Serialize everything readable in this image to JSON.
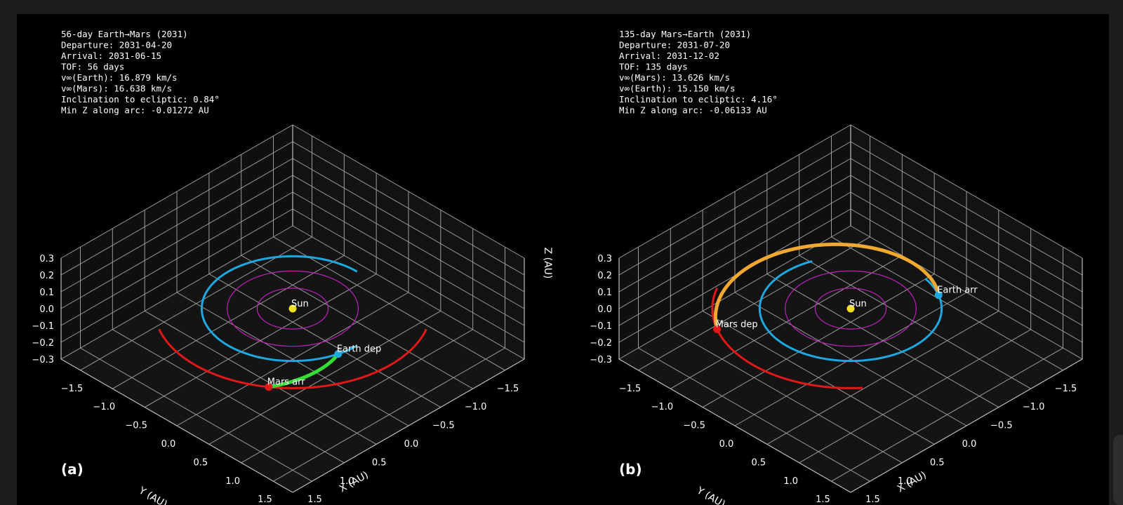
{
  "chart_data": [
    {
      "type": "line3d",
      "panel_label": "(a)",
      "info_lines": [
        "56-day Earth→Mars (2031)",
        "Departure: 2031-04-20",
        "Arrival:   2031-06-15",
        "TOF: 56 days",
        "v∞(Earth):  16.879 km/s",
        "v∞(Mars):  16.638 km/s",
        "Inclination to ecliptic:  0.84°",
        "Min Z along arc: -0.01272 AU"
      ],
      "xlabel": "X (AU)",
      "ylabel": "Y (AU)",
      "zlabel": "Z (AU)",
      "xlim": [
        -1.8,
        1.8
      ],
      "ylim": [
        -1.8,
        1.8
      ],
      "zlim": [
        -0.3,
        0.3
      ],
      "xticks": [
        -1.5,
        -1.0,
        -0.5,
        0.0,
        0.5,
        1.0,
        1.5
      ],
      "yticks": [
        -1.5,
        -1.0,
        -0.5,
        0.0,
        0.5,
        1.0,
        1.5
      ],
      "zticks": [
        0.3,
        0.2,
        0.1,
        0.0,
        -0.1,
        -0.2,
        -0.3
      ],
      "tick_labels_x": [
        "−1.5",
        "−1.0",
        "−0.5",
        "0.0",
        "0.5",
        "1.0",
        "1.5"
      ],
      "tick_labels_y": [
        "−1.5",
        "−1.0",
        "−0.5",
        "0.0",
        "0.5",
        "1.0",
        "1.5"
      ],
      "tick_labels_z": [
        "0.3",
        "0.2",
        "0.1",
        "0.0",
        "−0.1",
        "−0.2",
        "−0.3"
      ],
      "colors": {
        "earth": "#1fa8e0",
        "mars": "#e01818",
        "transfer": "#33dd33",
        "inner": "#c020c0",
        "sun": "#f0e020"
      },
      "inner_orbits_au": [
        0.39,
        0.72
      ],
      "earth_orbit": {
        "radius_au": 1.0,
        "arc_deg": [
          0,
          270
        ]
      },
      "mars_orbit": {
        "radius_au": 1.52,
        "arc_deg": [
          -30,
          120
        ]
      },
      "transfer": {
        "from_deg": 15,
        "to_deg": 55,
        "r0_au": 1.0,
        "r1_au": 1.52
      },
      "markers": [
        {
          "name": "Sun",
          "label": "Sun",
          "x": 0,
          "y": 0,
          "z": 0,
          "color": "#f0e020"
        },
        {
          "name": "earth-dep",
          "label": "Earth dep",
          "angle_deg": 15,
          "r_au": 1.0,
          "color": "#1fa8e0"
        },
        {
          "name": "mars-arr",
          "label": "Mars arr",
          "angle_deg": 55,
          "r_au": 1.52,
          "color": "#e01818"
        }
      ]
    },
    {
      "type": "line3d",
      "panel_label": "(b)",
      "info_lines": [
        "135-day Mars→Earth (2031)",
        "Departure: 2031-07-20",
        "Arrival:   2031-12-02",
        "TOF: 135 days",
        "v∞(Mars):  13.626 km/s",
        "v∞(Earth):  15.150 km/s",
        "Inclination to ecliptic:  4.16°",
        "Min Z along arc: -0.06133 AU"
      ],
      "xlabel": "X (AU)",
      "ylabel": "Y (AU)",
      "zlabel": "",
      "xlim": [
        -1.8,
        1.8
      ],
      "ylim": [
        -1.8,
        1.8
      ],
      "zlim": [
        -0.3,
        0.3
      ],
      "xticks": [
        -1.5,
        -1.0,
        -0.5,
        0.0,
        0.5,
        1.0,
        1.5
      ],
      "yticks": [
        -1.5,
        -1.0,
        -0.5,
        0.0,
        0.5,
        1.0,
        1.5
      ],
      "zticks": [
        0.3,
        0.2,
        0.1,
        0.0,
        -0.1,
        -0.2,
        -0.3
      ],
      "tick_labels_x": [
        "−1.5",
        "−1.0",
        "−0.5",
        "0.0",
        "0.5",
        "1.0",
        "1.5"
      ],
      "tick_labels_y": [
        "−1.5",
        "−1.0",
        "−0.5",
        "0.0",
        "0.5",
        "1.0",
        "1.5"
      ],
      "tick_labels_z": [
        "0.3",
        "0.2",
        "0.1",
        "0.0",
        "−0.1",
        "−0.2",
        "−0.3"
      ],
      "colors": {
        "earth": "#1fa8e0",
        "mars": "#e01818",
        "transfer": "#f0a830",
        "inner": "#c020c0",
        "sun": "#f0e020"
      },
      "inner_orbits_au": [
        0.39,
        0.72
      ],
      "earth_orbit": {
        "radius_au": 1.0,
        "arc_deg": [
          -80,
          200
        ]
      },
      "mars_orbit": {
        "radius_au": 1.52,
        "arc_deg": [
          40,
          150
        ]
      },
      "transfer": {
        "from_deg": 120,
        "to_deg": 300,
        "r0_au": 1.52,
        "r1_au": 1.0
      },
      "markers": [
        {
          "name": "Sun",
          "label": "Sun",
          "x": 0,
          "y": 0,
          "z": 0,
          "color": "#f0e020"
        },
        {
          "name": "mars-dep",
          "label": "Mars dep",
          "angle_deg": 120,
          "r_au": 1.52,
          "color": "#e01818"
        },
        {
          "name": "earth-arr",
          "label": "Earth arr",
          "angle_deg": 300,
          "r_au": 1.0,
          "color": "#1fa8e0"
        }
      ]
    }
  ]
}
